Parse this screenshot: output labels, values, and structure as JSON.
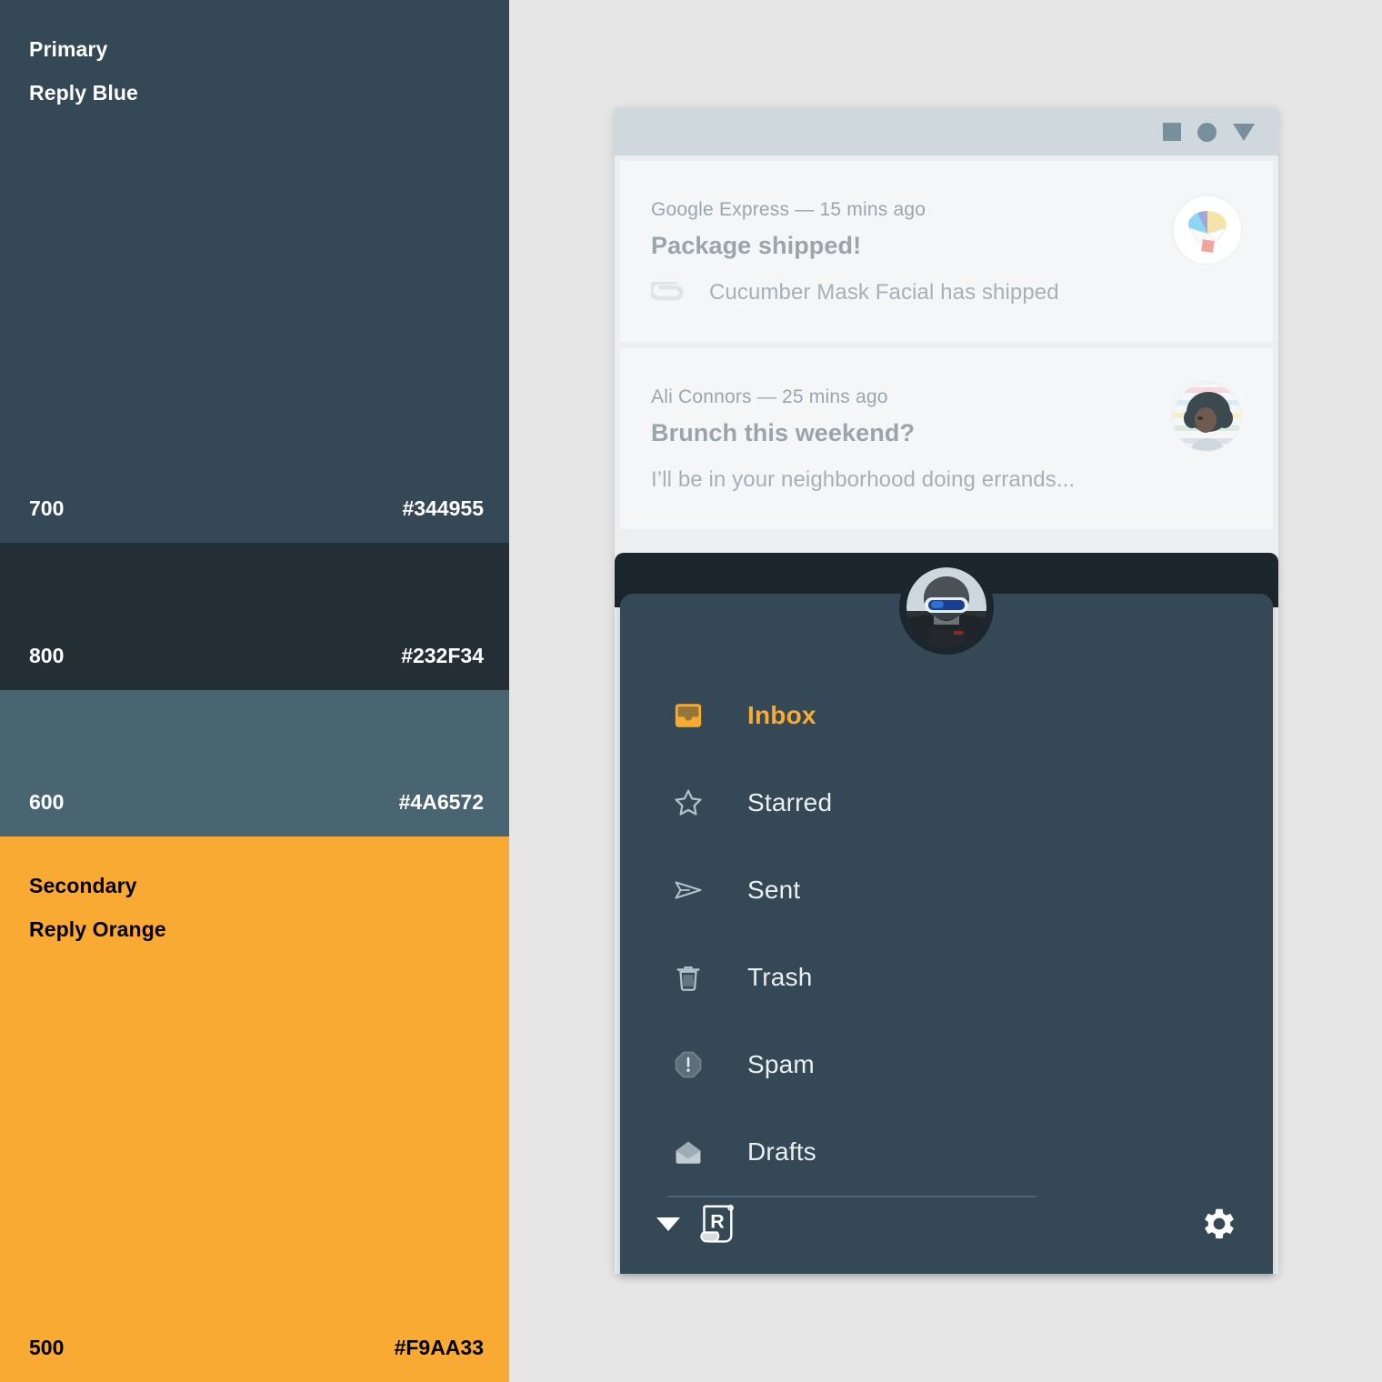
{
  "palette": {
    "primary": {
      "label_line1": "Primary",
      "label_line2": "Reply Blue",
      "swatches": [
        {
          "tone": "700",
          "hex": "#344955"
        },
        {
          "tone": "800",
          "hex": "#232F34"
        },
        {
          "tone": "600",
          "hex": "#4A6572"
        }
      ]
    },
    "secondary": {
      "label_line1": "Secondary",
      "label_line2": "Reply Orange",
      "swatches": [
        {
          "tone": "500",
          "hex": "#F9AA33"
        }
      ]
    }
  },
  "window": {
    "titlebar": {
      "icons": [
        "square-icon",
        "circle-icon",
        "triangle-down-icon"
      ]
    }
  },
  "mail": {
    "items": [
      {
        "meta": "Google Express — 15 mins ago",
        "subject": "Package shipped!",
        "snippet": "Cucumber Mask Facial has shipped",
        "attachment_icon": "paperclip-icon",
        "avatar": "parachute-avatar"
      },
      {
        "meta": "Ali Connors — 25 mins ago",
        "subject": "Brunch this weekend?",
        "snippet": "I’ll be in your neighborhood doing errands...",
        "attachment_icon": "",
        "avatar": "ali-connors-avatar"
      }
    ]
  },
  "drawer": {
    "avatar": "user-avatar-skier",
    "items": [
      {
        "label": "Inbox",
        "icon": "inbox-icon",
        "active": true
      },
      {
        "label": "Starred",
        "icon": "star-icon",
        "active": false
      },
      {
        "label": "Sent",
        "icon": "send-icon",
        "active": false
      },
      {
        "label": "Trash",
        "icon": "trash-icon",
        "active": false
      },
      {
        "label": "Spam",
        "icon": "spam-icon",
        "active": false
      },
      {
        "label": "Drafts",
        "icon": "drafts-icon",
        "active": false
      }
    ],
    "footer": {
      "caret_icon": "caret-down-icon",
      "brand_logo": "reply-logo-icon",
      "brand_letter": "R",
      "settings_icon": "gear-icon"
    }
  },
  "colors": {
    "primary_700": "#344955",
    "primary_800": "#232F34",
    "primary_600": "#4A6572",
    "secondary_500": "#F9AA33",
    "canvas_bg": "#E6E6E6",
    "titlebar_bg": "#CFD8DC"
  }
}
